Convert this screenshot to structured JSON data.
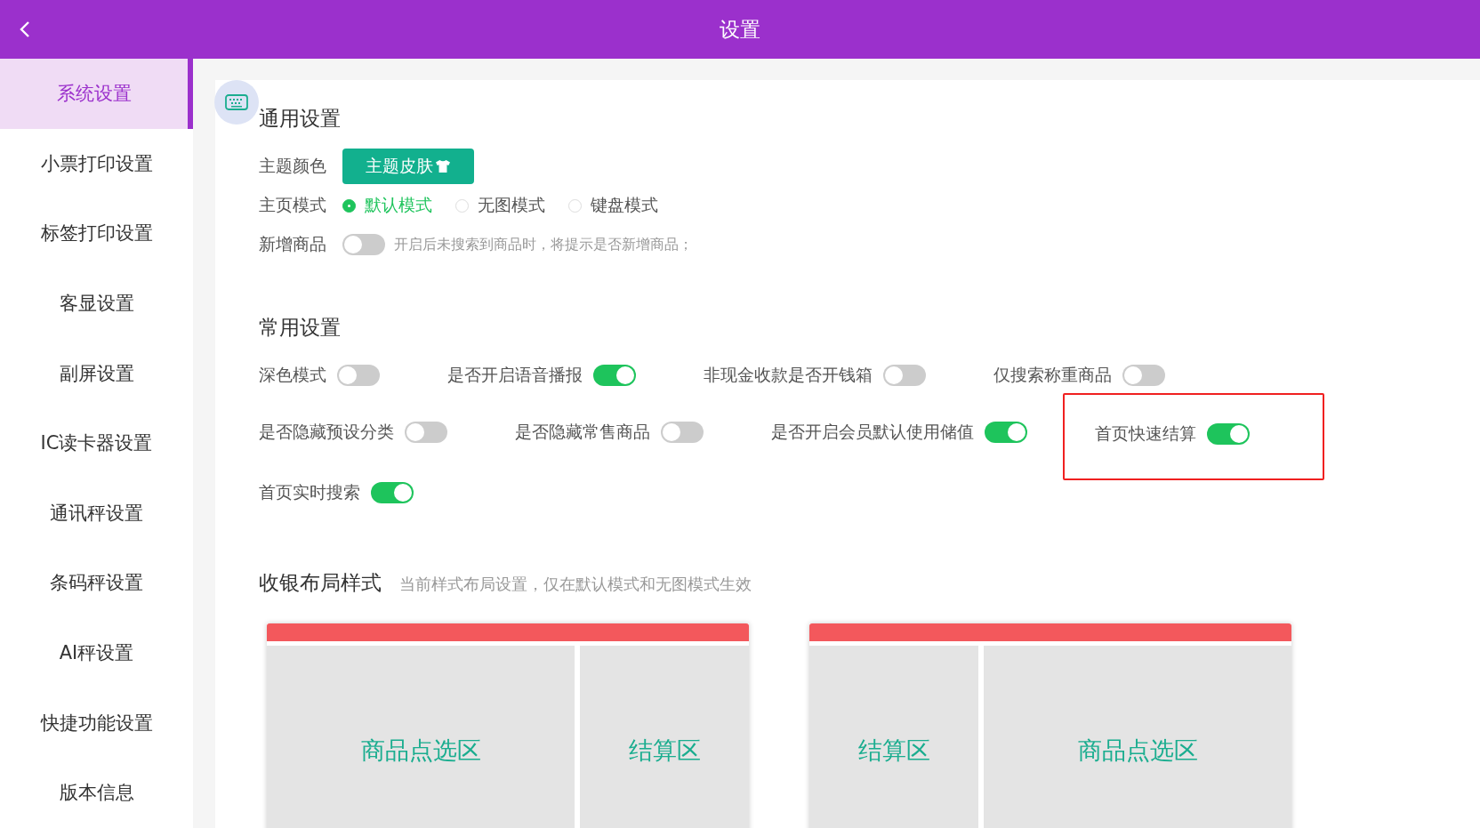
{
  "header": {
    "title": "设置"
  },
  "sidebar": {
    "items": [
      {
        "label": "系统设置",
        "selected": true
      },
      {
        "label": "小票打印设置",
        "selected": false
      },
      {
        "label": "标签打印设置",
        "selected": false
      },
      {
        "label": "客显设置",
        "selected": false
      },
      {
        "label": "副屏设置",
        "selected": false
      },
      {
        "label": "IC读卡器设置",
        "selected": false
      },
      {
        "label": "通讯秤设置",
        "selected": false
      },
      {
        "label": "条码秤设置",
        "selected": false
      },
      {
        "label": "AI秤设置",
        "selected": false
      },
      {
        "label": "快捷功能设置",
        "selected": false
      },
      {
        "label": "版本信息",
        "selected": false
      }
    ]
  },
  "general": {
    "title": "通用设置",
    "theme": {
      "label": "主题颜色",
      "button": "主题皮肤"
    },
    "home_mode": {
      "label": "主页模式",
      "options": [
        {
          "label": "默认模式",
          "selected": true
        },
        {
          "label": "无图模式",
          "selected": false
        },
        {
          "label": "键盘模式",
          "selected": false
        }
      ]
    },
    "new_goods": {
      "label": "新增商品",
      "on": false,
      "hint": "开启后未搜索到商品时，将提示是否新增商品；"
    }
  },
  "common": {
    "title": "常用设置",
    "items": [
      {
        "label": "深色模式",
        "on": false,
        "highlighted": false
      },
      {
        "label": "是否开启语音播报",
        "on": true,
        "highlighted": false
      },
      {
        "label": "非现金收款是否开钱箱",
        "on": false,
        "highlighted": false
      },
      {
        "label": "仅搜索称重商品",
        "on": false,
        "highlighted": false
      },
      {
        "label": "是否隐藏预设分类",
        "on": false,
        "highlighted": false
      },
      {
        "label": "是否隐藏常售商品",
        "on": false,
        "highlighted": false
      },
      {
        "label": "是否开启会员默认使用储值",
        "on": true,
        "highlighted": false
      },
      {
        "label": "首页快速结算",
        "on": true,
        "highlighted": true
      },
      {
        "label": "首页实时搜索",
        "on": true,
        "highlighted": false
      }
    ]
  },
  "layout": {
    "title": "收银布局样式",
    "hint": "当前样式布局设置，仅在默认模式和无图模式生效",
    "styles": [
      {
        "panes": [
          {
            "kind": "goods",
            "label": "商品点选区"
          },
          {
            "kind": "checkout",
            "label": "结算区"
          }
        ]
      },
      {
        "panes": [
          {
            "kind": "checkout",
            "label": "结算区"
          },
          {
            "kind": "goods",
            "label": "商品点选区"
          }
        ]
      }
    ]
  }
}
